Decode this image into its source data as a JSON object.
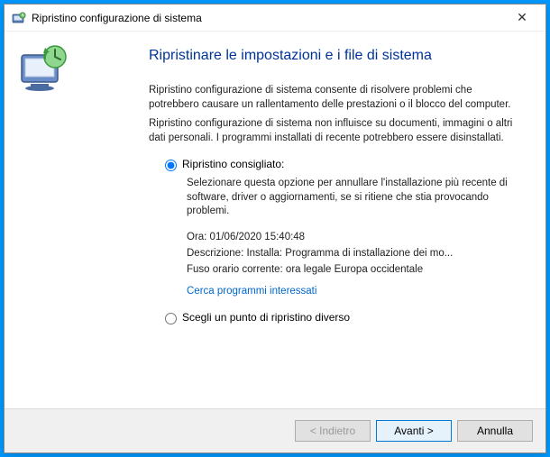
{
  "window": {
    "title": "Ripristino configurazione di sistema"
  },
  "heading": "Ripristinare le impostazioni e i file di sistema",
  "desc1": "Ripristino configurazione di sistema consente di risolvere problemi che potrebbero causare un rallentamento delle prestazioni o il blocco del computer.",
  "desc2": "Ripristino configurazione di sistema non influisce su documenti, immagini o altri dati personali. I programmi installati di recente potrebbero essere disinstallati.",
  "radio": {
    "recommended": {
      "label": "Ripristino consigliato:",
      "sub": "Selezionare questa opzione per annullare l'installazione più recente di software, driver o aggiornamenti, se si ritiene che stia provocando problemi.",
      "time": "Ora: 01/06/2020 15:40:48",
      "description": "Descrizione: Installa: Programma di installazione dei mo...",
      "timezone": "Fuso orario corrente: ora legale Europa occidentale",
      "link": "Cerca programmi interessati"
    },
    "choose": {
      "label": "Scegli un punto di ripristino diverso"
    }
  },
  "buttons": {
    "back": "< Indietro",
    "next": "Avanti >",
    "cancel": "Annulla"
  },
  "icons": {
    "close": "✕"
  }
}
